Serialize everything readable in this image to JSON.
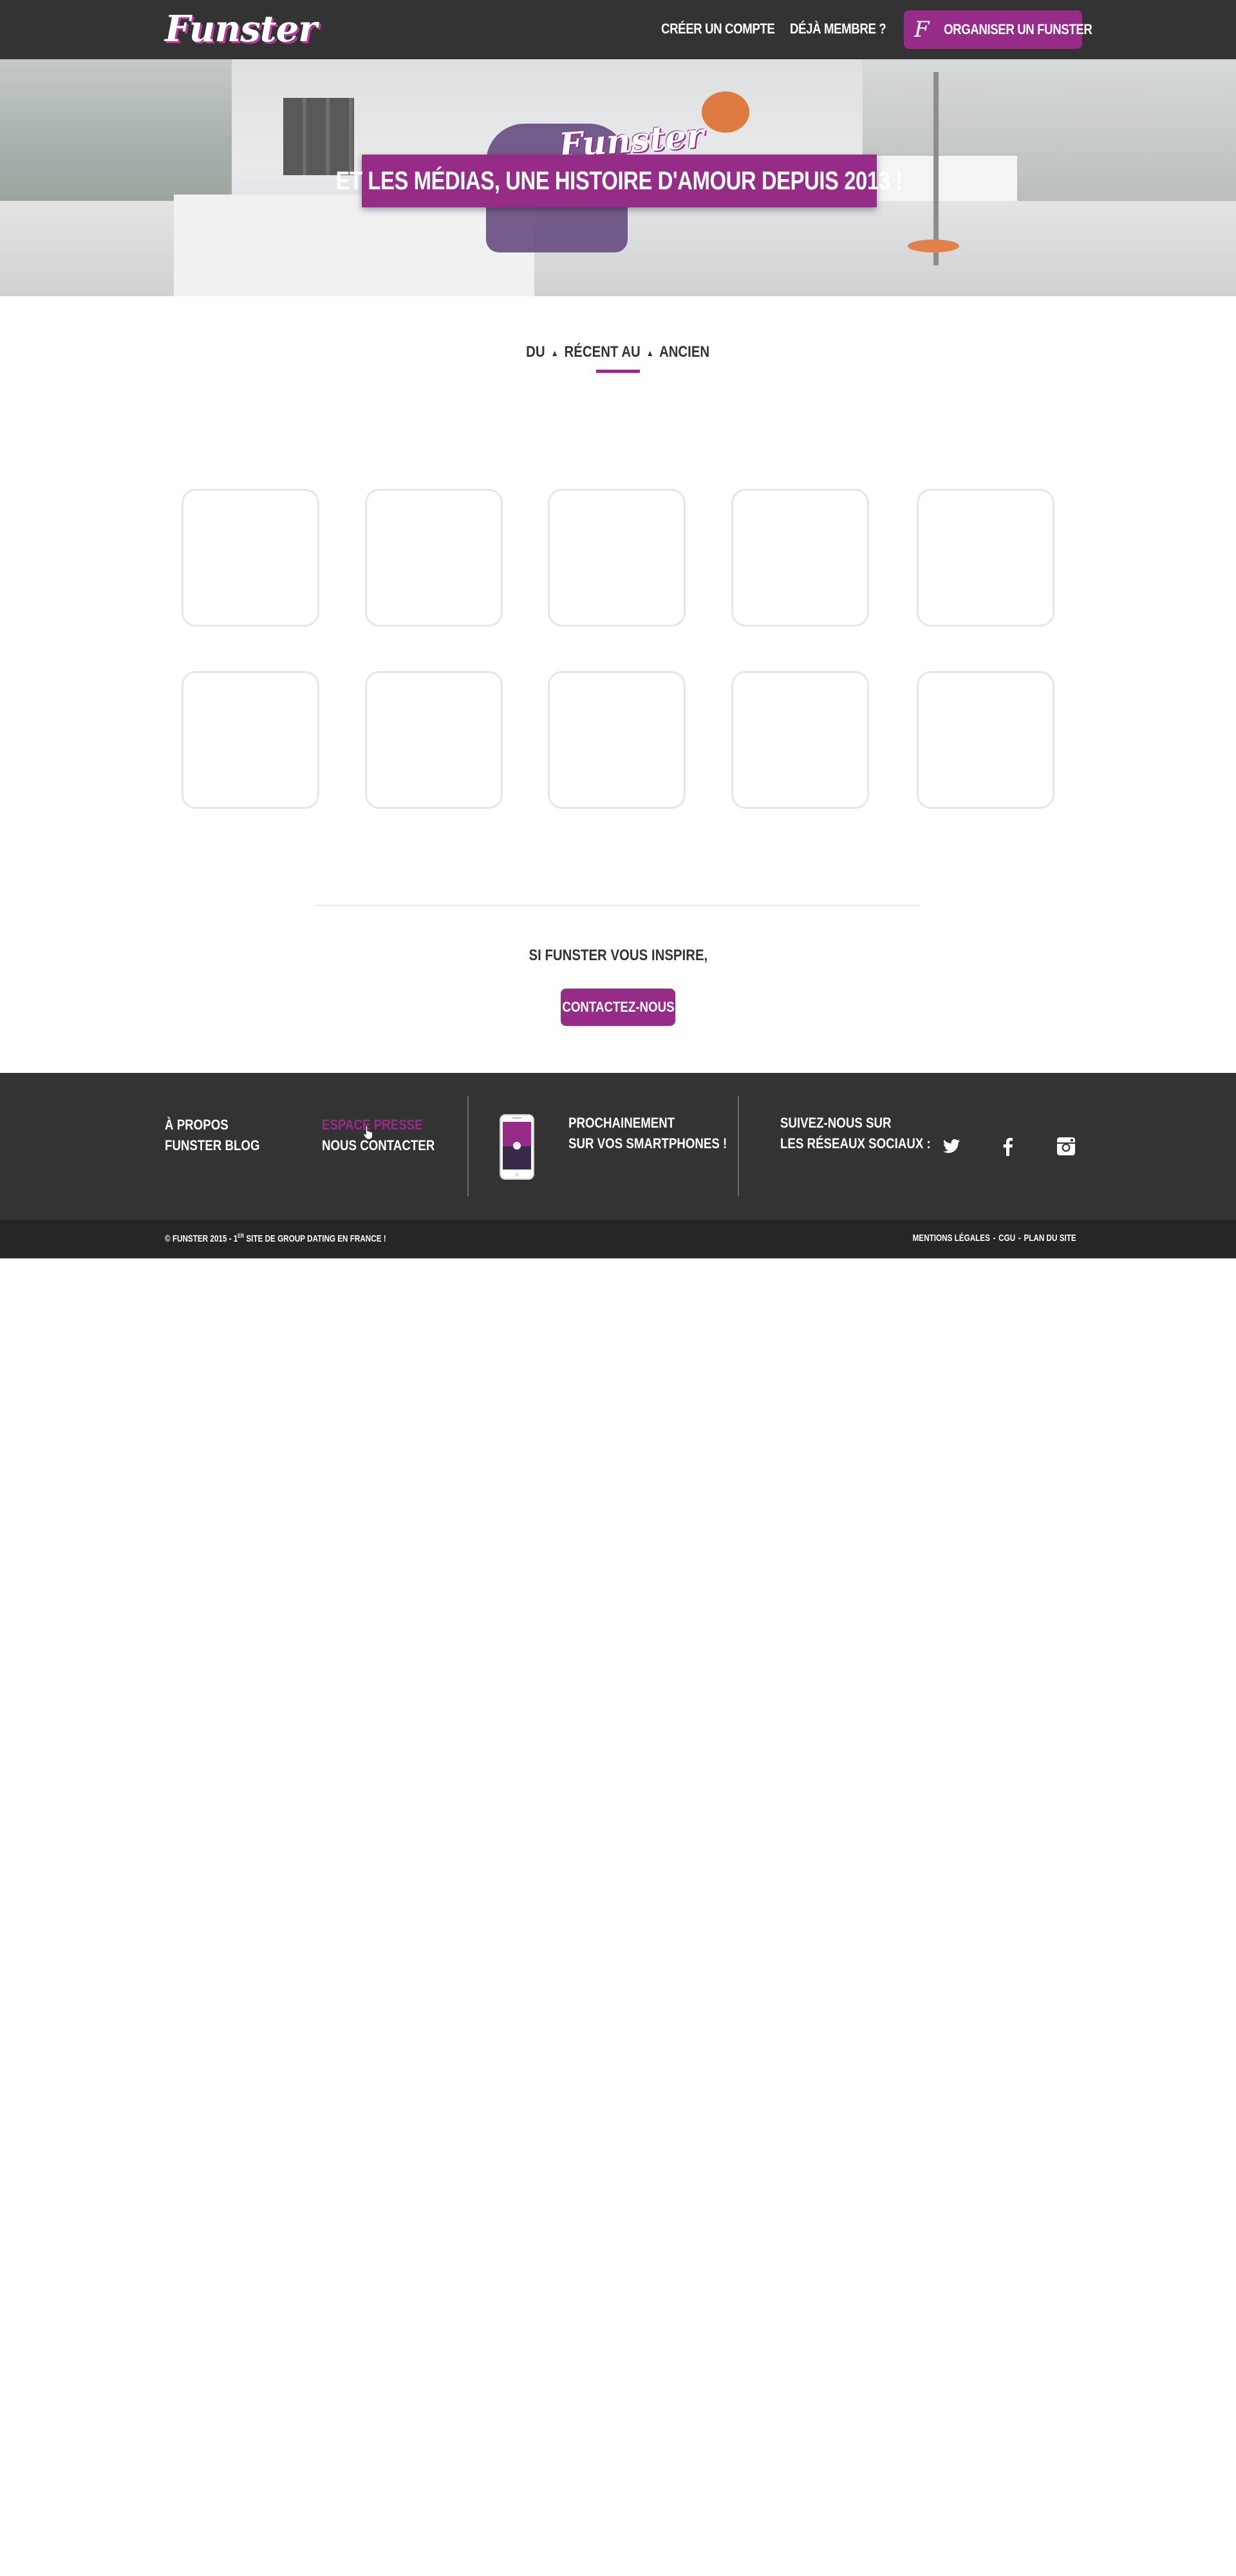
{
  "header": {
    "logo_text": "Funster",
    "nav": {
      "create_account": "Créer un compte",
      "already_member": "Déjà membre ?",
      "organize_icon": "F",
      "organize_label": "Organiser un Funster"
    }
  },
  "hero": {
    "logo_text": "Funster",
    "headline": "Et les médias, une histoire d'amour depuis 2013 !"
  },
  "sort": {
    "prefix": "Du",
    "recent": "récent",
    "middle": "au",
    "old": "ancien",
    "arrow_icon": "triangle-up-icon"
  },
  "media_grid": {
    "tiles": [
      "",
      "",
      "",
      "",
      "",
      "",
      "",
      "",
      "",
      ""
    ]
  },
  "inspire": {
    "text": "Si Funster vous inspire,",
    "button": "Contactez-nous"
  },
  "footer": {
    "links_col1": [
      "À propos",
      "Funster blog"
    ],
    "links_col2": [
      "Espace presse",
      "Nous contacter"
    ],
    "active_link": "Espace presse",
    "app_text_line1": "Prochainement",
    "app_text_line2": "sur vos smartphones !",
    "social_text_line1": "Suivez-nous sur",
    "social_text_line2": "les réseaux sociaux :",
    "social_icons": [
      "twitter-icon",
      "facebook-icon",
      "instagram-icon"
    ]
  },
  "subfooter": {
    "copyright_prefix": "© Funster 2015 - 1",
    "copyright_sup": "er",
    "copyright_suffix": " site de group dating en France !",
    "legal_links": [
      "Mentions légales",
      "CGU",
      "Plan du site"
    ],
    "separator": "-"
  },
  "colors": {
    "brand_purple": "#962c88",
    "header_bg": "#333333",
    "subfooter_bg": "#262626"
  }
}
